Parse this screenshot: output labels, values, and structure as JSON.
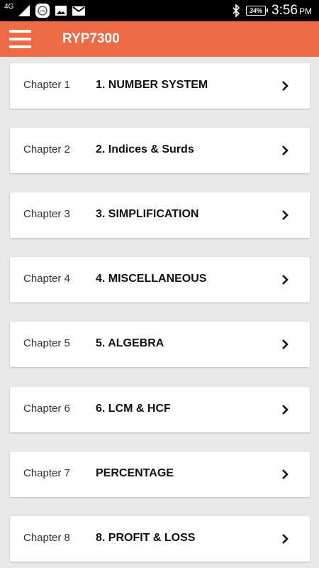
{
  "status_bar": {
    "network": "4G",
    "battery": "34%",
    "time": "3:56",
    "ampm": "PM",
    "icons": [
      "signal-icon",
      "notification-mi-icon",
      "image-icon",
      "mail-icon",
      "bluetooth-icon",
      "battery-icon"
    ]
  },
  "app_bar": {
    "title": "RYP7300",
    "menu_icon": "hamburger-menu-icon"
  },
  "chapters": [
    {
      "label": "Chapter 1",
      "title": "1. NUMBER SYSTEM"
    },
    {
      "label": "Chapter 2",
      "title": "2. Indices & Surds"
    },
    {
      "label": "Chapter 3",
      "title": "3. SIMPLIFICATION"
    },
    {
      "label": "Chapter 4",
      "title": "4. MISCELLANEOUS"
    },
    {
      "label": "Chapter 5",
      "title": "5. ALGEBRA"
    },
    {
      "label": "Chapter 6",
      "title": "6. LCM & HCF"
    },
    {
      "label": "Chapter 7",
      "title": "PERCENTAGE"
    },
    {
      "label": "Chapter 8",
      "title": "8. PROFIT & LOSS"
    }
  ],
  "colors": {
    "app_bar": "#ee6a45",
    "background": "#e9e9e9",
    "card": "#ffffff"
  }
}
